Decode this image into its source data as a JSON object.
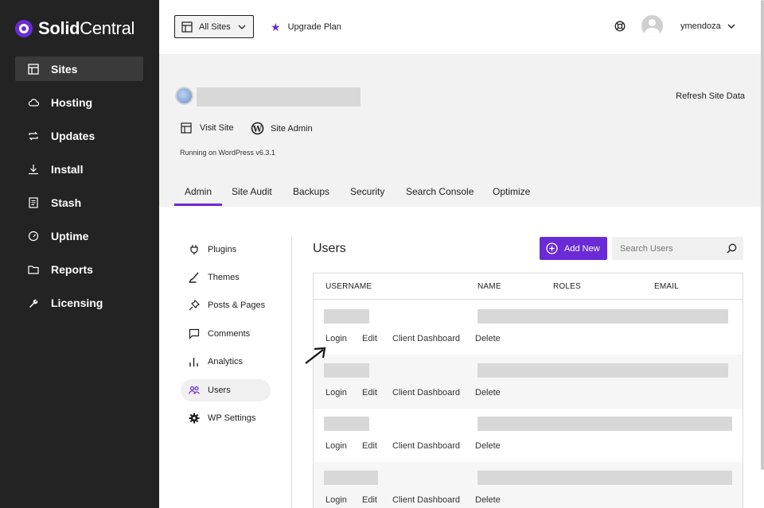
{
  "brand": {
    "bold": "Solid",
    "light": "Central"
  },
  "sidebar": {
    "items": [
      {
        "label": "Sites",
        "icon": "layout-icon",
        "active": true
      },
      {
        "label": "Hosting",
        "icon": "cloud-icon"
      },
      {
        "label": "Updates",
        "icon": "refresh-icon"
      },
      {
        "label": "Install",
        "icon": "download-icon"
      },
      {
        "label": "Stash",
        "icon": "document-icon"
      },
      {
        "label": "Uptime",
        "icon": "gauge-icon"
      },
      {
        "label": "Reports",
        "icon": "folder-icon"
      },
      {
        "label": "Licensing",
        "icon": "wrench-icon"
      }
    ]
  },
  "header": {
    "site_select": "All Sites",
    "upgrade": "Upgrade Plan",
    "username": "ymendoza"
  },
  "site": {
    "refresh": "Refresh Site Data",
    "visit": "Visit Site",
    "admin": "Site Admin",
    "running": "Running on WordPress v6.3.1"
  },
  "tabs": [
    "Admin",
    "Site Audit",
    "Backups",
    "Security",
    "Search Console",
    "Optimize"
  ],
  "submenu": [
    "Plugins",
    "Themes",
    "Posts & Pages",
    "Comments",
    "Analytics",
    "Users",
    "WP Settings"
  ],
  "users": {
    "title": "Users",
    "add_new": "Add New",
    "search_placeholder": "Search Users",
    "columns": [
      "USERNAME",
      "NAME",
      "ROLES",
      "EMAIL"
    ],
    "actions": [
      "Login",
      "Edit",
      "Client Dashboard",
      "Delete"
    ]
  },
  "colors": {
    "accent": "#6a2bd6",
    "sidebar": "#232323"
  }
}
